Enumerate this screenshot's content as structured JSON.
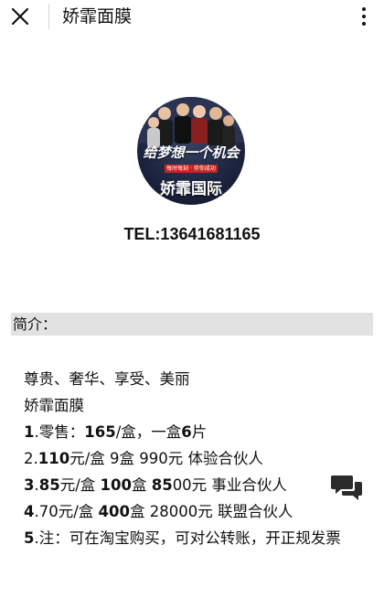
{
  "header": {
    "title": "娇霏面膜",
    "close_icon": "close-icon",
    "more_icon": "more-vertical-icon"
  },
  "profile": {
    "avatar_slogan": "给梦想一个机会",
    "avatar_ribbon": "每时每刻 · 伴你成功",
    "avatar_brand": "娇霏国际",
    "tel": "TEL:13641681165"
  },
  "section": {
    "header": "简介："
  },
  "content": {
    "line1": "尊贵、奢华、享受、美丽",
    "line2": "娇霏面膜",
    "item1": {
      "num": "1",
      "text_a": ".零售：",
      "price": "165",
      "text_b": "/盒，一盒",
      "count": "6",
      "text_c": "片"
    },
    "item2": {
      "num": "2",
      "text_a": ".",
      "price": "110",
      "text_b": "元/盒 9盒 990元 体验合伙人"
    },
    "item3": {
      "num": "3",
      "text_a": ".",
      "price": "85",
      "text_b": "元/盒 ",
      "qty": "100",
      "text_c": "盒 ",
      "total": "85",
      "text_d": "00元 事业合伙人"
    },
    "item4": {
      "num": "4",
      "text_a": ".70元/盒 ",
      "qty": "400",
      "text_b": "盒 28000元 联盟合伙人"
    },
    "item5": {
      "num": "5",
      "text_a": ".注：可在淘宝购买，可对公转账，开正规发票"
    }
  },
  "chat": {
    "icon": "chat-bubbles-icon"
  }
}
